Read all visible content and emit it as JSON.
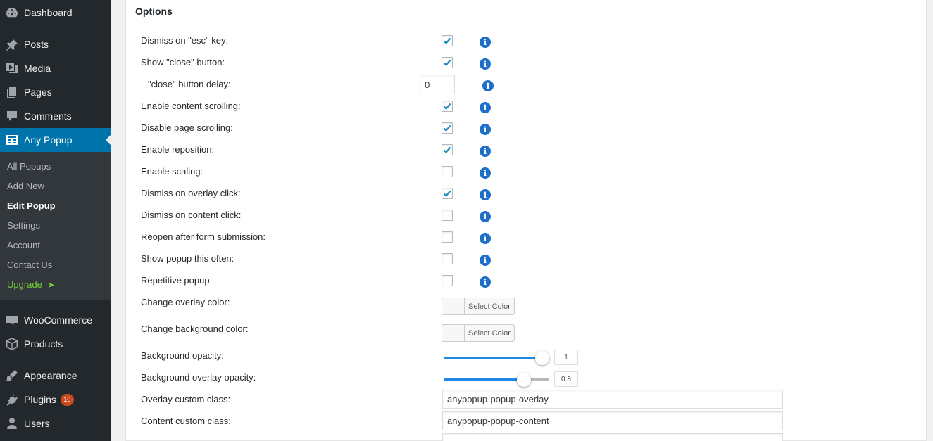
{
  "sidebar": {
    "menu": [
      {
        "label": "Dashboard",
        "icon": "dashboard-icon"
      },
      {
        "label": "Posts",
        "icon": "pin-icon"
      },
      {
        "label": "Media",
        "icon": "media-icon"
      },
      {
        "label": "Pages",
        "icon": "pages-icon"
      },
      {
        "label": "Comments",
        "icon": "comment-icon"
      },
      {
        "label": "Any Popup",
        "icon": "table-icon"
      },
      {
        "label": "WooCommerce",
        "icon": "woo-icon"
      },
      {
        "label": "Products",
        "icon": "box-icon"
      },
      {
        "label": "Appearance",
        "icon": "brush-icon"
      },
      {
        "label": "Plugins",
        "icon": "plugin-icon",
        "badge": "10"
      },
      {
        "label": "Users",
        "icon": "user-icon"
      }
    ],
    "submenu": [
      "All Popups",
      "Add New",
      "Edit Popup",
      "Settings",
      "Account",
      "Contact Us",
      "Upgrade"
    ],
    "upgrade_arrow": "➤",
    "colors": {
      "bg": "#23282d",
      "active": "#0073aa",
      "upgrade": "#7ad03a",
      "badge": "#ca4a1f"
    }
  },
  "panel": {
    "title": "Options",
    "checkbox_rows": [
      {
        "label": "Dismiss on \"esc\" key:",
        "checked": true
      },
      {
        "label": "Show \"close\" button:",
        "checked": true
      },
      {
        "label": "Enable content scrolling:",
        "checked": true
      },
      {
        "label": "Disable page scrolling:",
        "checked": true
      },
      {
        "label": "Enable reposition:",
        "checked": true
      },
      {
        "label": "Enable scaling:",
        "checked": false
      },
      {
        "label": "Dismiss on overlay click:",
        "checked": true
      },
      {
        "label": "Dismiss on content click:",
        "checked": false
      },
      {
        "label": "Reopen after form submission:",
        "checked": false
      },
      {
        "label": "Show popup this often:",
        "checked": false
      },
      {
        "label": "Repetitive popup:",
        "checked": false
      }
    ],
    "close_delay": {
      "label": "\"close\" button delay:",
      "value": "0"
    },
    "overlay_color": {
      "label": "Change overlay color:",
      "button": "Select Color"
    },
    "background_color": {
      "label": "Change background color:",
      "button": "Select Color"
    },
    "bg_opacity": {
      "label": "Background opacity:",
      "value": "1",
      "fraction": 1.0
    },
    "overlay_opacity": {
      "label": "Background overlay opacity:",
      "value": "0.8",
      "fraction": 0.8
    },
    "overlay_class": {
      "label": "Overlay custom class:",
      "value": "anypopup-popup-overlay"
    },
    "content_class": {
      "label": "Content custom class:",
      "value": "anypopup-popup-content"
    },
    "accent": "#1e88e5"
  }
}
